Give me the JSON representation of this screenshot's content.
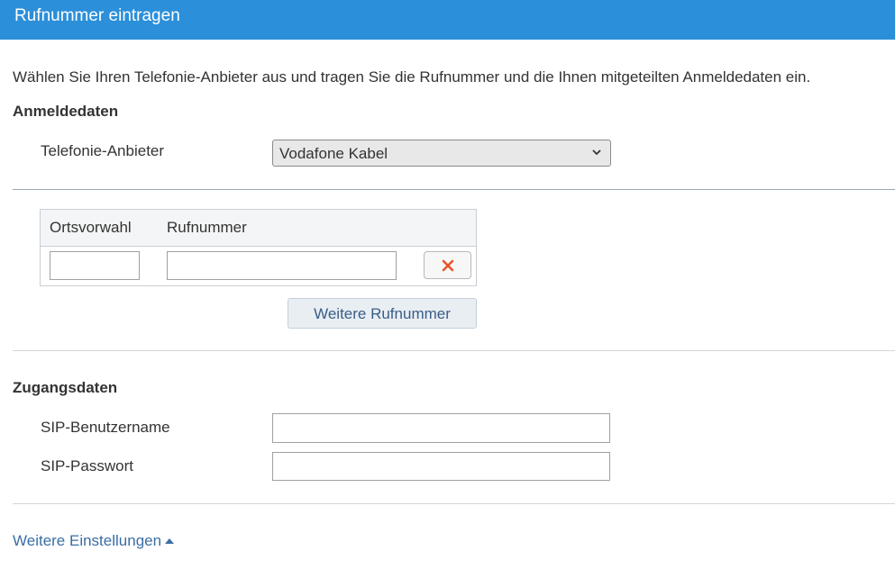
{
  "header": {
    "title": "Rufnummer eintragen"
  },
  "intro": "Wählen Sie Ihren Telefonie-Anbieter aus und tragen Sie die Rufnummer und die Ihnen mitgeteilten Anmeldedaten ein.",
  "anmeldedaten": {
    "title": "Anmeldedaten",
    "provider_label": "Telefonie-Anbieter",
    "provider_value": "Vodafone Kabel"
  },
  "numbers_table": {
    "headers": [
      "Ortsvorwahl",
      "Rufnummer"
    ],
    "rows": [
      {
        "ortsvorwahl": "",
        "rufnummer": ""
      }
    ],
    "delete_icon": "close-icon",
    "add_button_label": "Weitere Rufnummer"
  },
  "zugangsdaten": {
    "title": "Zugangsdaten",
    "sip_user_label": "SIP-Benutzername",
    "sip_user_value": "",
    "sip_password_label": "SIP-Passwort",
    "sip_password_value": ""
  },
  "more_settings": {
    "label": "Weitere Einstellungen",
    "icon": "caret-up-icon"
  },
  "colors": {
    "header_bg": "#2b8fd9",
    "delete_icon": "#e8542c",
    "link": "#3a6ea5"
  }
}
